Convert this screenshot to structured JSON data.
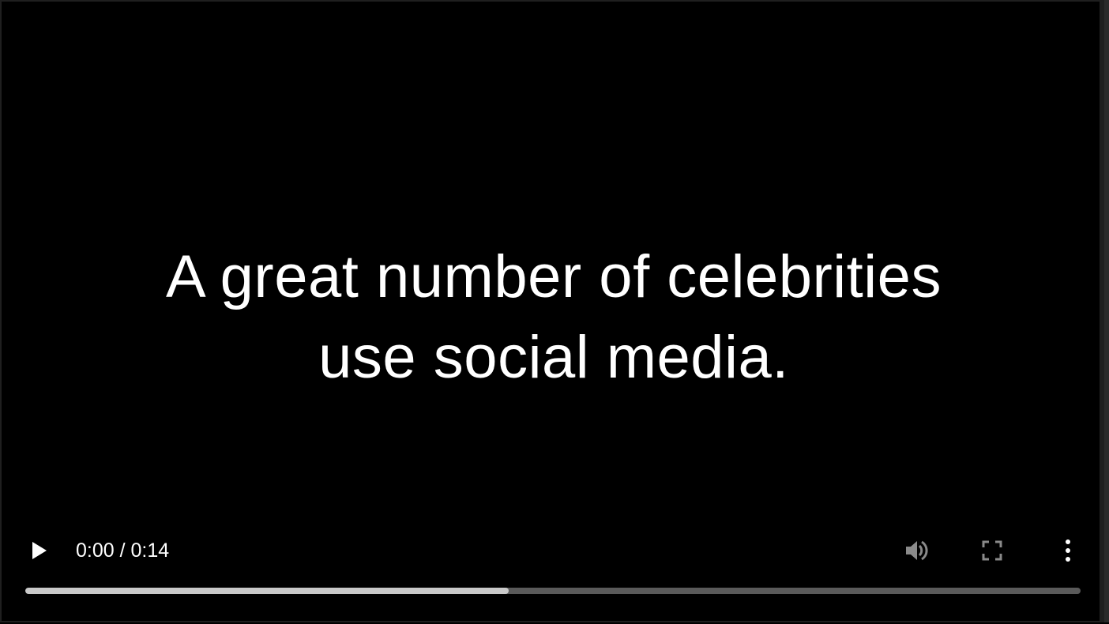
{
  "video": {
    "caption_lines": [
      "A great number of celebrities",
      "use social media."
    ]
  },
  "controls": {
    "current_time": "0:00",
    "separator": " / ",
    "duration": "0:14",
    "play_icon": "play-icon",
    "volume_icon": "volume-icon",
    "fullscreen_icon": "fullscreen-icon",
    "more_icon": "more-vertical-icon",
    "buffered_fraction": 0.458
  },
  "colors": {
    "background": "#000000",
    "text": "#ffffff",
    "icon_dim": "#8a8a8a",
    "track": "#5a5a5a",
    "buffered": "#c9c9c9"
  }
}
